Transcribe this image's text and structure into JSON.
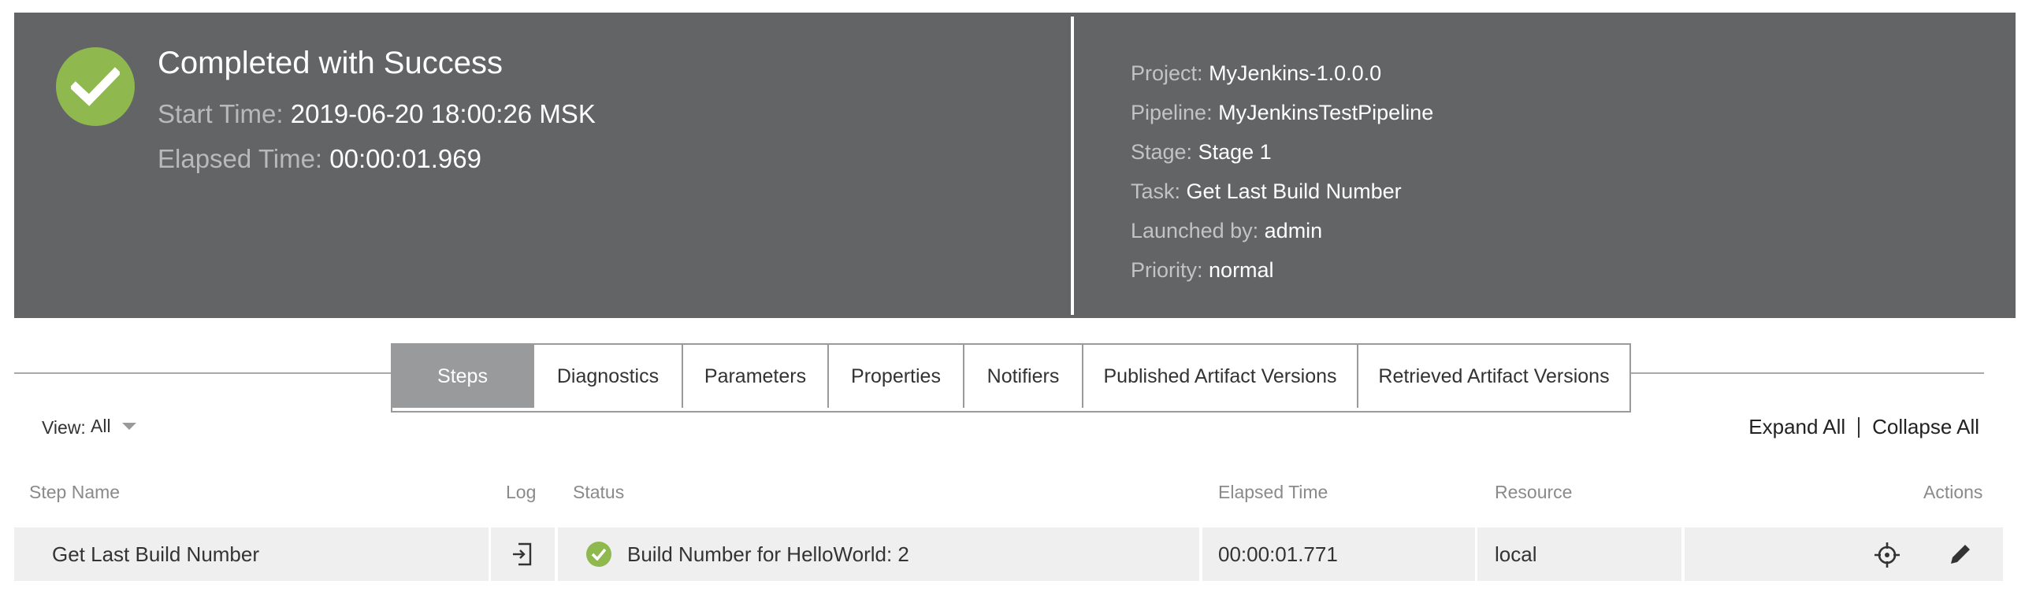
{
  "summary": {
    "status_title": "Completed with Success",
    "start_time_label": "Start Time:",
    "start_time_value": "2019-06-20 18:00:26 MSK",
    "elapsed_time_label": "Elapsed Time:",
    "elapsed_time_value": "00:00:01.969",
    "status_color": "#8fb84f",
    "panel_color": "#636466"
  },
  "details": {
    "project_label": "Project:",
    "project_value": "MyJenkins-1.0.0.0",
    "pipeline_label": "Pipeline:",
    "pipeline_value": "MyJenkinsTestPipeline",
    "stage_label": "Stage:",
    "stage_value": "Stage 1",
    "task_label": "Task:",
    "task_value": "Get Last Build Number",
    "launched_label": "Launched by:",
    "launched_value": "admin",
    "priority_label": "Priority:",
    "priority_value": "normal"
  },
  "tabs": [
    {
      "label": "Steps",
      "active": true
    },
    {
      "label": "Diagnostics"
    },
    {
      "label": "Parameters"
    },
    {
      "label": "Properties"
    },
    {
      "label": "Notifiers"
    },
    {
      "label": "Published Artifact Versions"
    },
    {
      "label": "Retrieved Artifact Versions"
    }
  ],
  "view": {
    "label": "View:",
    "selected": "All"
  },
  "controls": {
    "expand_all": "Expand All",
    "collapse_all": "Collapse All"
  },
  "table": {
    "headers": {
      "step_name": "Step Name",
      "log": "Log",
      "status": "Status",
      "elapsed_time": "Elapsed Time",
      "resource": "Resource",
      "actions": "Actions"
    },
    "rows": [
      {
        "step_name": "Get Last Build Number",
        "status": "Build Number for HelloWorld: 2",
        "elapsed_time": "00:00:01.771",
        "resource": "local"
      }
    ]
  },
  "icons": {
    "status": "check-circle-icon",
    "log": "log-file-icon",
    "locate": "crosshair-icon",
    "edit": "pencil-icon"
  }
}
